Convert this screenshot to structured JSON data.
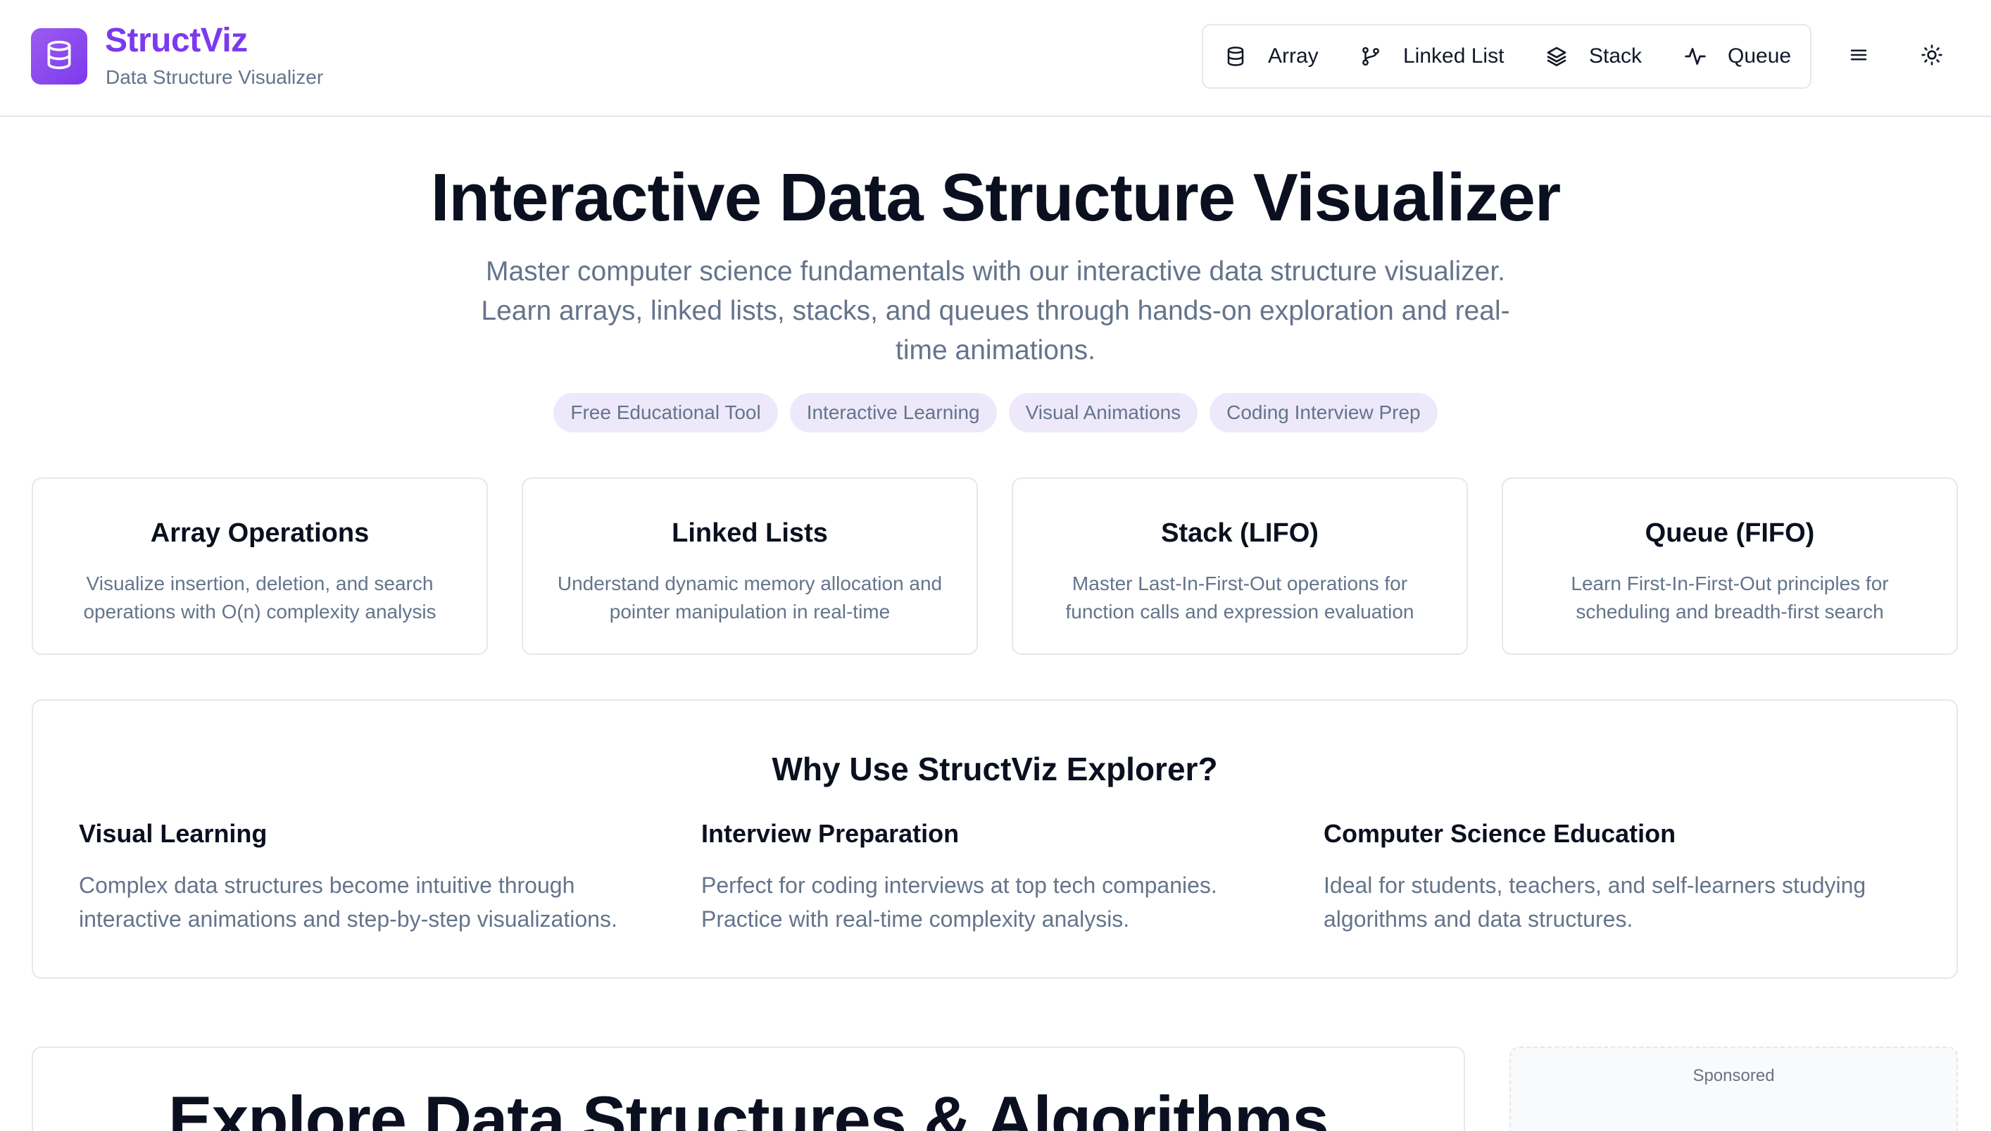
{
  "header": {
    "brand_name": "StructViz",
    "brand_subtitle": "Data Structure Visualizer",
    "logo_icon": "database-icon",
    "nav": [
      {
        "label": "Array",
        "icon": "database-icon"
      },
      {
        "label": "Linked List",
        "icon": "git-branch-icon"
      },
      {
        "label": "Stack",
        "icon": "layers-icon"
      },
      {
        "label": "Queue",
        "icon": "activity-icon"
      }
    ],
    "menu_icon": "hamburger-menu-icon",
    "theme_icon": "sun-icon"
  },
  "hero": {
    "title": "Interactive Data Structure Visualizer",
    "description": "Master computer science fundamentals with our interactive data structure visualizer. Learn arrays, linked lists, stacks, and queues through hands-on exploration and real-time animations.",
    "tags": [
      "Free Educational Tool",
      "Interactive Learning",
      "Visual Animations",
      "Coding Interview Prep"
    ]
  },
  "cards": [
    {
      "title": "Array Operations",
      "text": "Visualize insertion, deletion, and search operations with O(n) complexity analysis"
    },
    {
      "title": "Linked Lists",
      "text": "Understand dynamic memory allocation and pointer manipulation in real-time"
    },
    {
      "title": "Stack (LIFO)",
      "text": "Master Last-In-First-Out operations for function calls and expression evaluation"
    },
    {
      "title": "Queue (FIFO)",
      "text": "Learn First-In-First-Out principles for scheduling and breadth-first search"
    }
  ],
  "why": {
    "title": "Why Use StructViz Explorer?",
    "columns": [
      {
        "title": "Visual Learning",
        "text": "Complex data structures become intuitive through interactive animations and step-by-step visualizations."
      },
      {
        "title": "Interview Preparation",
        "text": "Perfect for coding interviews at top tech companies. Practice with real-time complexity analysis."
      },
      {
        "title": "Computer Science Education",
        "text": "Ideal for students, teachers, and self-learners studying algorithms and data structures."
      }
    ]
  },
  "explore": {
    "title": "Explore Data Structures & Algorithms"
  },
  "sponsor": {
    "label": "Sponsored"
  },
  "colors": {
    "accent": "#7c3aed",
    "tag_bg": "#ede9fb",
    "muted_text": "#64748b",
    "border": "#e5e7eb"
  }
}
